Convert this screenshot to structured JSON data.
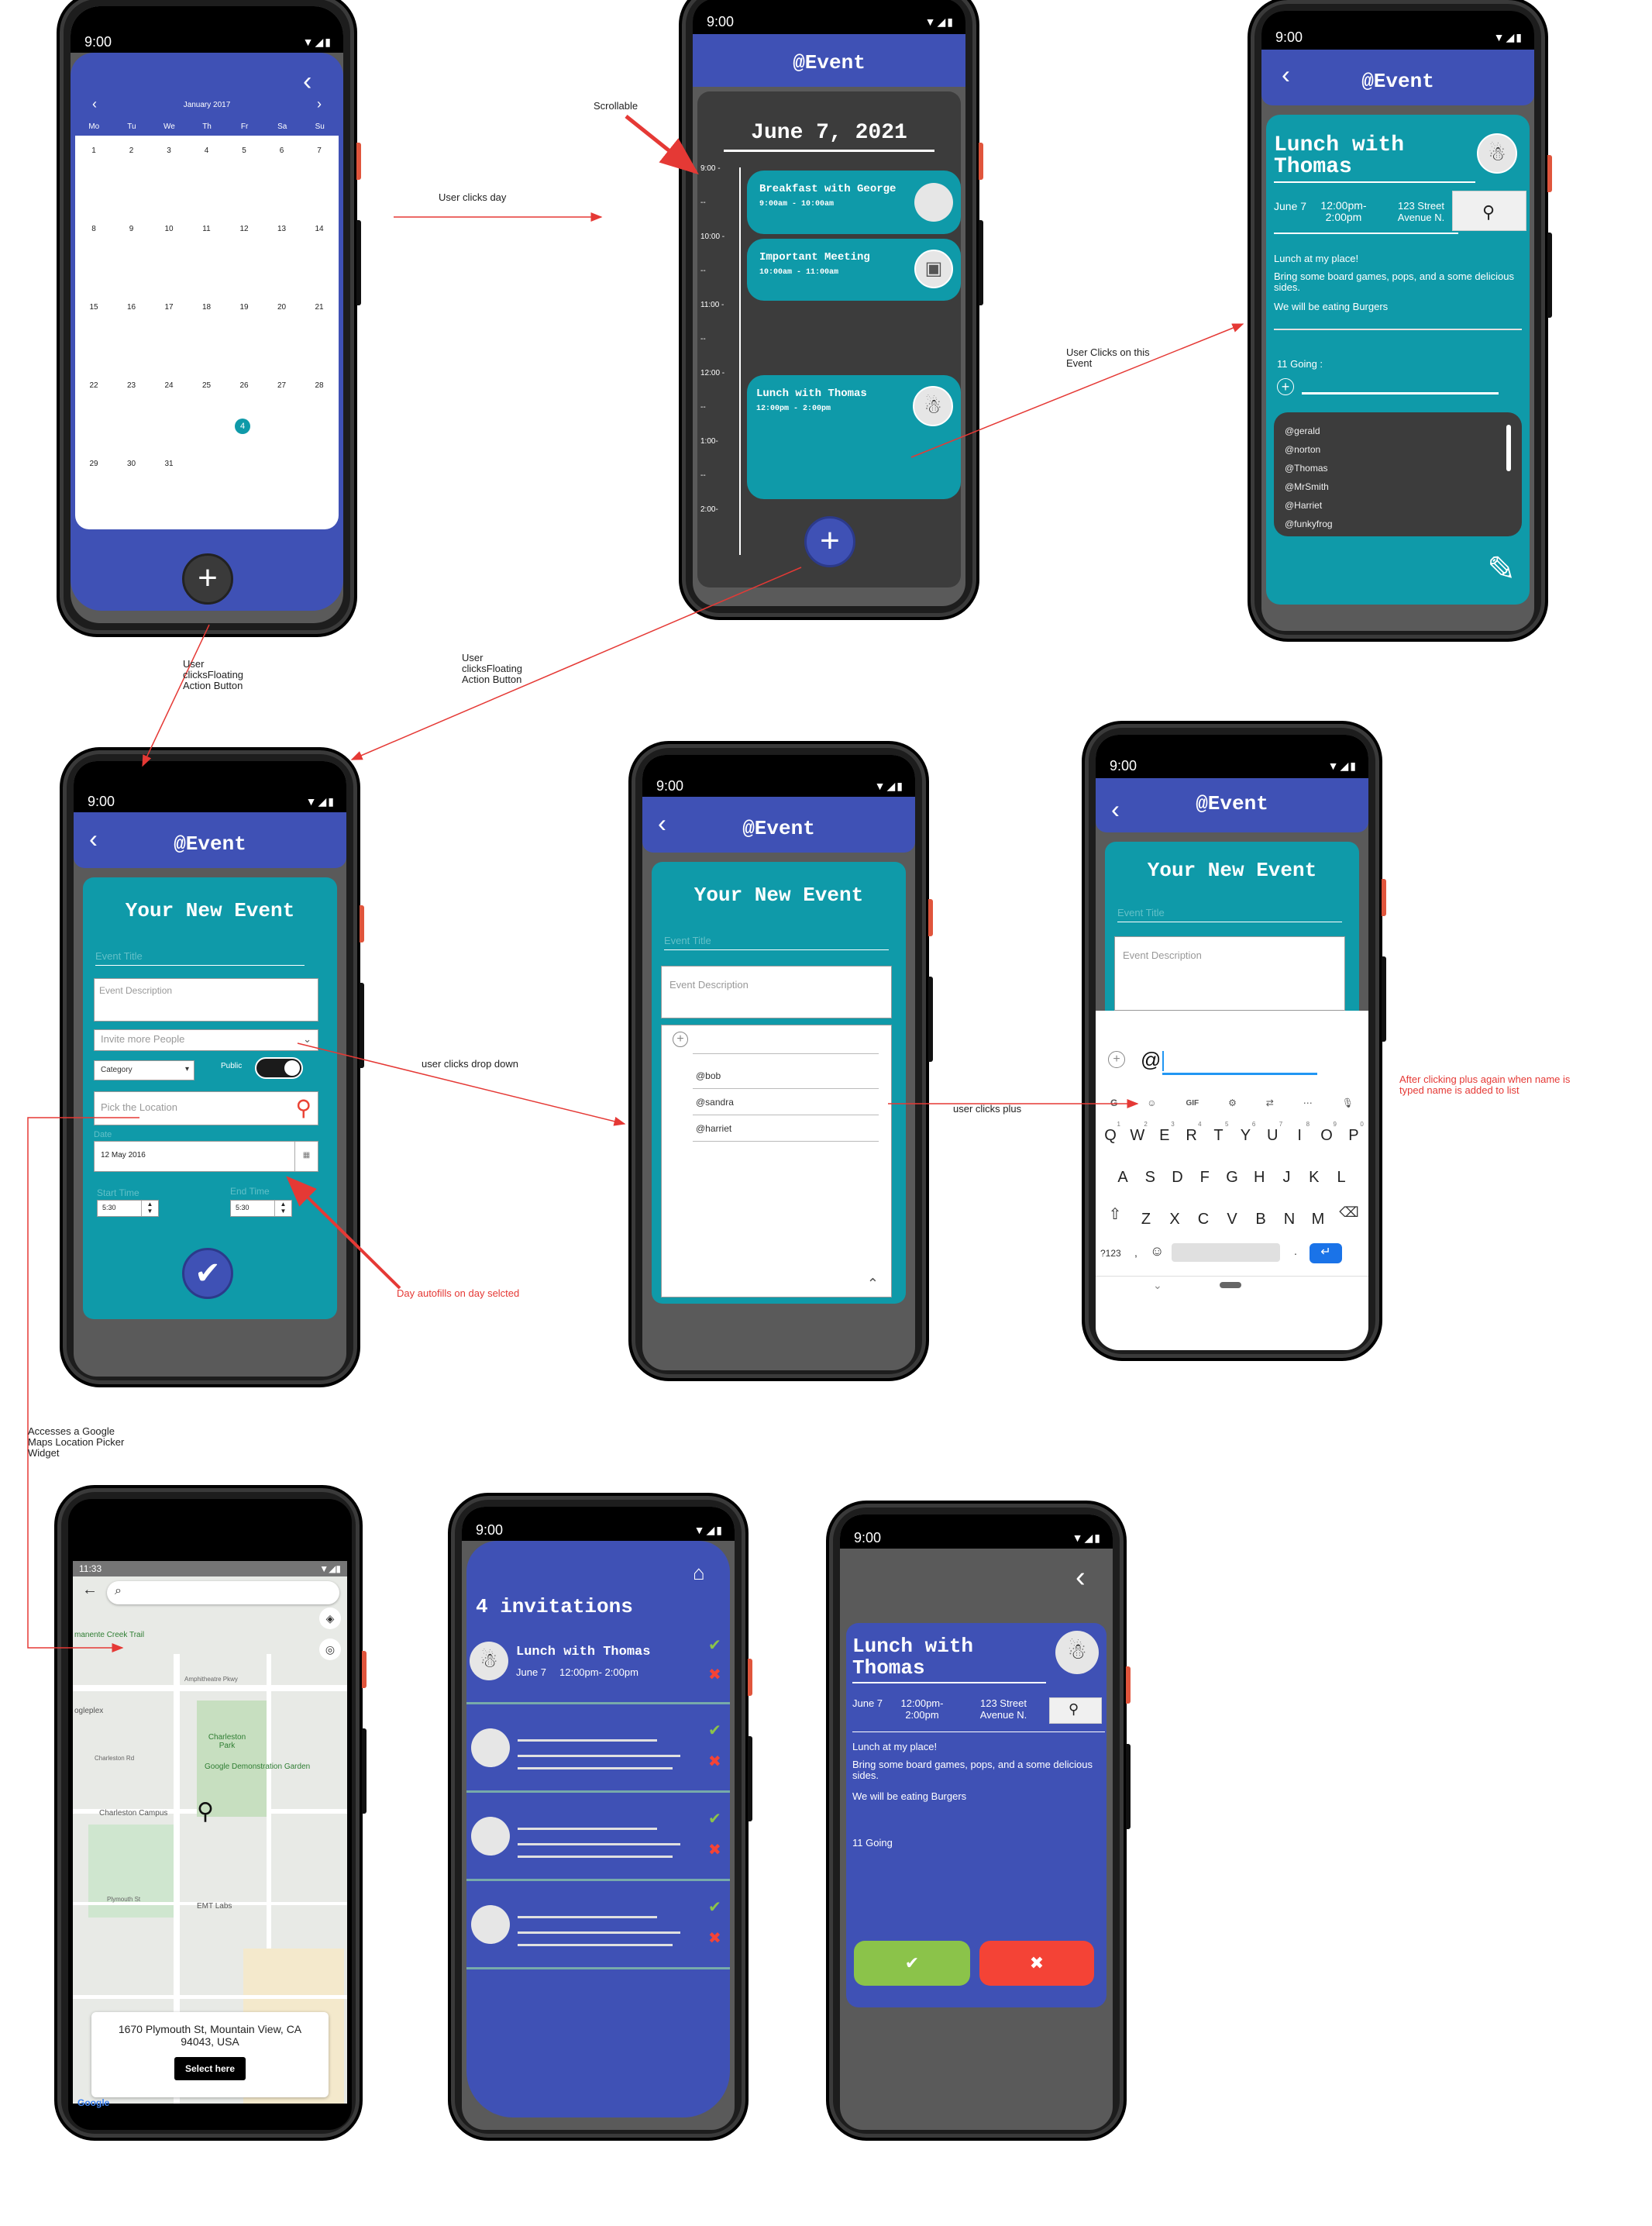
{
  "status": {
    "time": "9:00",
    "map_time": "11:33"
  },
  "app_title": "@Event",
  "calendar": {
    "month": "January 2017",
    "weekdays": [
      "Mo",
      "Tu",
      "We",
      "Th",
      "Fr",
      "Sa",
      "Su"
    ],
    "weeks": [
      [
        "1",
        "2",
        "3",
        "4",
        "5",
        "6",
        "7"
      ],
      [
        "8",
        "9",
        "10",
        "11",
        "12",
        "13",
        "14"
      ],
      [
        "15",
        "16",
        "17",
        "18",
        "19",
        "20",
        "21"
      ],
      [
        "22",
        "23",
        "24",
        "25",
        "26",
        "27",
        "28"
      ],
      [
        "29",
        "30",
        "31",
        "",
        "",
        "",
        ""
      ]
    ],
    "badge_day": "4",
    "prev": "‹",
    "next": "›"
  },
  "day_view": {
    "date": "June 7, 2021",
    "times": [
      "9:00 -",
      "--",
      "10:00 -",
      "--",
      "11:00 -",
      "--",
      "12:00 -",
      "--",
      "1:00-",
      "--",
      "2:00-"
    ],
    "events": [
      {
        "title": "Breakfast with George",
        "time": "9:00am - 10:00am"
      },
      {
        "title": "Important Meeting",
        "time": "10:00am - 11:00am"
      },
      {
        "title": "Lunch with Thomas",
        "time": "12:00pm - 2:00pm"
      }
    ]
  },
  "detail": {
    "title": "Lunch with Thomas",
    "date": "June 7",
    "time": "12:00pm- 2:00pm",
    "address": "123 Street Avenue N.",
    "desc1": "Lunch at my place!",
    "desc2": "Bring some board games, pops, and a some delicious sides.",
    "desc3": "We will be eating Burgers",
    "going": "11 Going :",
    "going_plain": "11 Going",
    "attendees": [
      "@gerald",
      "@norton",
      "@Thomas",
      "@MrSmith",
      "@Harriet",
      "@funkyfrog"
    ]
  },
  "form": {
    "heading": "Your New Event",
    "title_placeholder": "Event Title",
    "desc_placeholder": "Event Description",
    "invite_placeholder": "Invite more People",
    "category": "Category",
    "public": "Public",
    "location_placeholder": "Pick the Location",
    "date_label": "Date",
    "date_value": "12 May 2016",
    "start_label": "Start Time",
    "end_label": "End Time",
    "start_value": "5:30",
    "end_value": "5:30",
    "invitees": [
      "@bob",
      "@sandra",
      "@harriet"
    ],
    "typing": "@"
  },
  "keyboard": {
    "row1": [
      "Q",
      "W",
      "E",
      "R",
      "T",
      "Y",
      "U",
      "I",
      "O",
      "P"
    ],
    "row1_num": [
      "1",
      "2",
      "3",
      "4",
      "5",
      "6",
      "7",
      "8",
      "9",
      "0"
    ],
    "row2": [
      "A",
      "S",
      "D",
      "F",
      "G",
      "H",
      "J",
      "K",
      "L"
    ],
    "row3": [
      "Z",
      "X",
      "C",
      "V",
      "B",
      "N",
      "M"
    ],
    "sym": "?123",
    "comma": ",",
    "period": ".",
    "tool_g": "G",
    "tool_gif": "GIF"
  },
  "map": {
    "labels": [
      "manente Creek Trail",
      "Charleston Park",
      "Google Demonstration Garden",
      "Charleston Campus",
      "EMT Labs",
      "ogleplex",
      "Charleston Rd",
      "Amphitheatre Pkwy",
      "Plymouth St"
    ],
    "address": "1670 Plymouth St, Mountain View, CA 94043, USA",
    "select": "Select here",
    "brand": "Google"
  },
  "invitations": {
    "heading": "4 invitations",
    "first_title": "Lunch with Thomas",
    "first_date": "June 7",
    "first_time": "12:00pm- 2:00pm"
  },
  "annotations": {
    "scrollable": "Scrollable",
    "clicks_day": "User clicks day",
    "clicks_event": "User Clicks on this Event",
    "fab1": "User clicksFloating Action Button",
    "fab2": "User clicksFloating Action Button",
    "dropdown": "user clicks drop down",
    "plus": "user clicks plus",
    "after_plus": "After clicking plus again when name is typed name is added to list",
    "autofill": "Day autofills on day selcted",
    "maps": "Accesses a Google Maps Location Picker Widget"
  },
  "colors": {
    "indigo": "#3f51b5",
    "teal": "#0f9aa9",
    "dark": "#3c3c3c",
    "accept": "#8bc34a",
    "decline": "#f44336",
    "arrow": "#e53935"
  }
}
